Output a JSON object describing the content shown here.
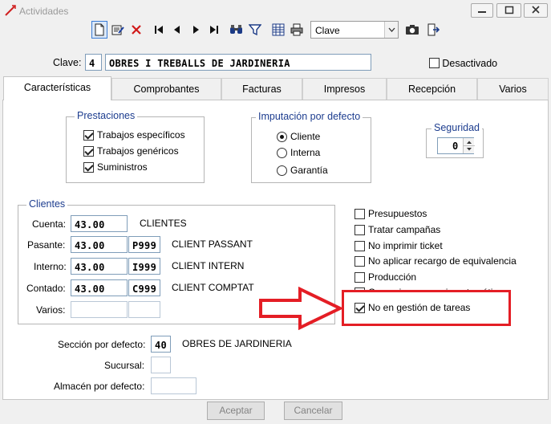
{
  "window": {
    "title": "Actividades"
  },
  "toolbar": {
    "order_select": "Clave"
  },
  "clave": {
    "label": "Clave:",
    "number": "4",
    "description": "OBRES I TREBALLS DE JARDINERIA",
    "desactivado_label": "Desactivado"
  },
  "tabs": [
    "Características",
    "Comprobantes",
    "Facturas",
    "Impresos",
    "Recepción",
    "Varios"
  ],
  "prestaciones": {
    "title": "Prestaciones",
    "items": [
      {
        "label": "Trabajos específicos",
        "checked": true
      },
      {
        "label": "Trabajos genéricos",
        "checked": true
      },
      {
        "label": "Suministros",
        "checked": true
      }
    ]
  },
  "imputacion": {
    "title": "Imputación por defecto",
    "options": [
      {
        "label": "Cliente",
        "selected": true
      },
      {
        "label": "Interna",
        "selected": false
      },
      {
        "label": "Garantía",
        "selected": false
      }
    ]
  },
  "seguridad": {
    "title": "Seguridad",
    "value": "0"
  },
  "clientes": {
    "title": "Clientes",
    "rows": [
      {
        "label": "Cuenta:",
        "account": "43.00",
        "code": "",
        "name": "CLIENTES"
      },
      {
        "label": "Pasante:",
        "account": "43.00",
        "code": "P999",
        "name": "CLIENT PASSANT"
      },
      {
        "label": "Interno:",
        "account": "43.00",
        "code": "I999",
        "name": "CLIENT INTERN"
      },
      {
        "label": "Contado:",
        "account": "43.00",
        "code": "C999",
        "name": "CLIENT COMPTAT"
      },
      {
        "label": "Varios:",
        "account": "",
        "code": "",
        "name": ""
      }
    ]
  },
  "options": [
    {
      "label": "Presupuestos",
      "checked": false
    },
    {
      "label": "Tratar campañas",
      "checked": false
    },
    {
      "label": "No imprimir ticket",
      "checked": false
    },
    {
      "label": "No aplicar recargo de equivalencia",
      "checked": false
    },
    {
      "label": "Producción",
      "checked": false
    },
    {
      "label": "Comunicar con caja automática",
      "checked": false
    },
    {
      "label": "No en gestión de tareas",
      "checked": true
    }
  ],
  "seccion": {
    "label": "Sección por defecto:",
    "value": "40",
    "name": "OBRES DE JARDINERIA"
  },
  "sucursal": {
    "label": "Sucursal:",
    "value": ""
  },
  "almacen": {
    "label": "Almacén por defecto:",
    "value": ""
  },
  "buttons": {
    "accept": "Aceptar",
    "cancel": "Cancelar"
  },
  "colors": {
    "annotation": "#e41e25",
    "group_title": "#1d3d8f"
  }
}
